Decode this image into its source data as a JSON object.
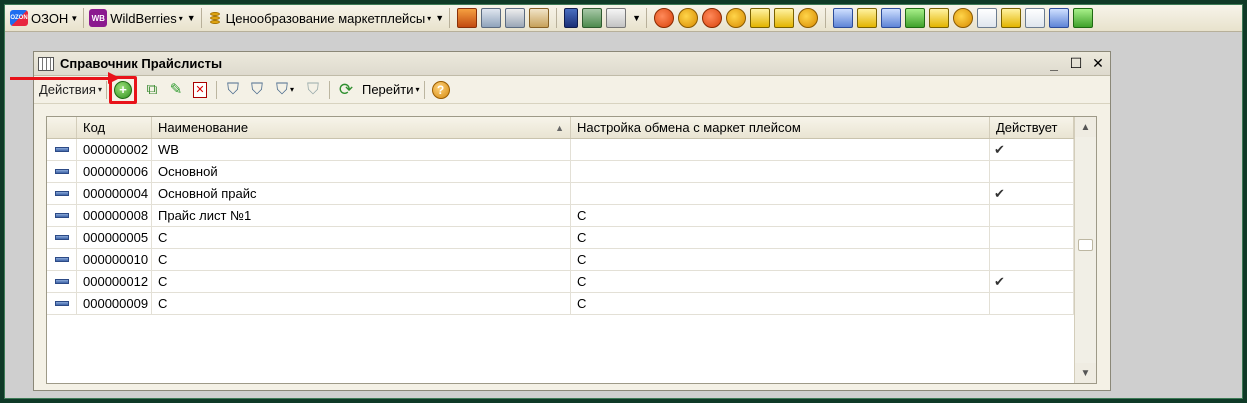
{
  "toolbar": {
    "ozon_label": "ОЗОН",
    "wb_label": "WildBerries",
    "pricing_label": "Ценообразование маркетплейсы",
    "wb_logo_text": "WB",
    "ozon_logo_text": "OZON"
  },
  "window": {
    "title": "Справочник Прайслисты",
    "minimize": "_",
    "maximize": "☐",
    "close": "✕"
  },
  "win_toolbar": {
    "actions_label": "Действия",
    "goto_label": "Перейти",
    "help": "?"
  },
  "table": {
    "columns": [
      "Код",
      "Наименование",
      "Настройка обмена с маркет плейсом",
      "Действует"
    ],
    "rows": [
      {
        "code": "000000002",
        "name": "WB",
        "setting": "",
        "active": "✔"
      },
      {
        "code": "000000006",
        "name": "Основной",
        "setting": "",
        "active": ""
      },
      {
        "code": "000000004",
        "name": "Основной прайс",
        "setting": "",
        "active": "✔"
      },
      {
        "code": "000000008",
        "name": "Прайс лист №1",
        "setting": "C",
        "active": ""
      },
      {
        "code": "000000005",
        "name": "C",
        "setting": "C",
        "active": ""
      },
      {
        "code": "000000010",
        "name": "C",
        "setting": "C",
        "active": ""
      },
      {
        "code": "000000012",
        "name": "C",
        "setting": "C",
        "active": "✔"
      },
      {
        "code": "000000009",
        "name": "C",
        "setting": "C",
        "active": ""
      }
    ]
  },
  "colors": {
    "annotation": "#e8121a",
    "desktop": "#0f3a27"
  }
}
